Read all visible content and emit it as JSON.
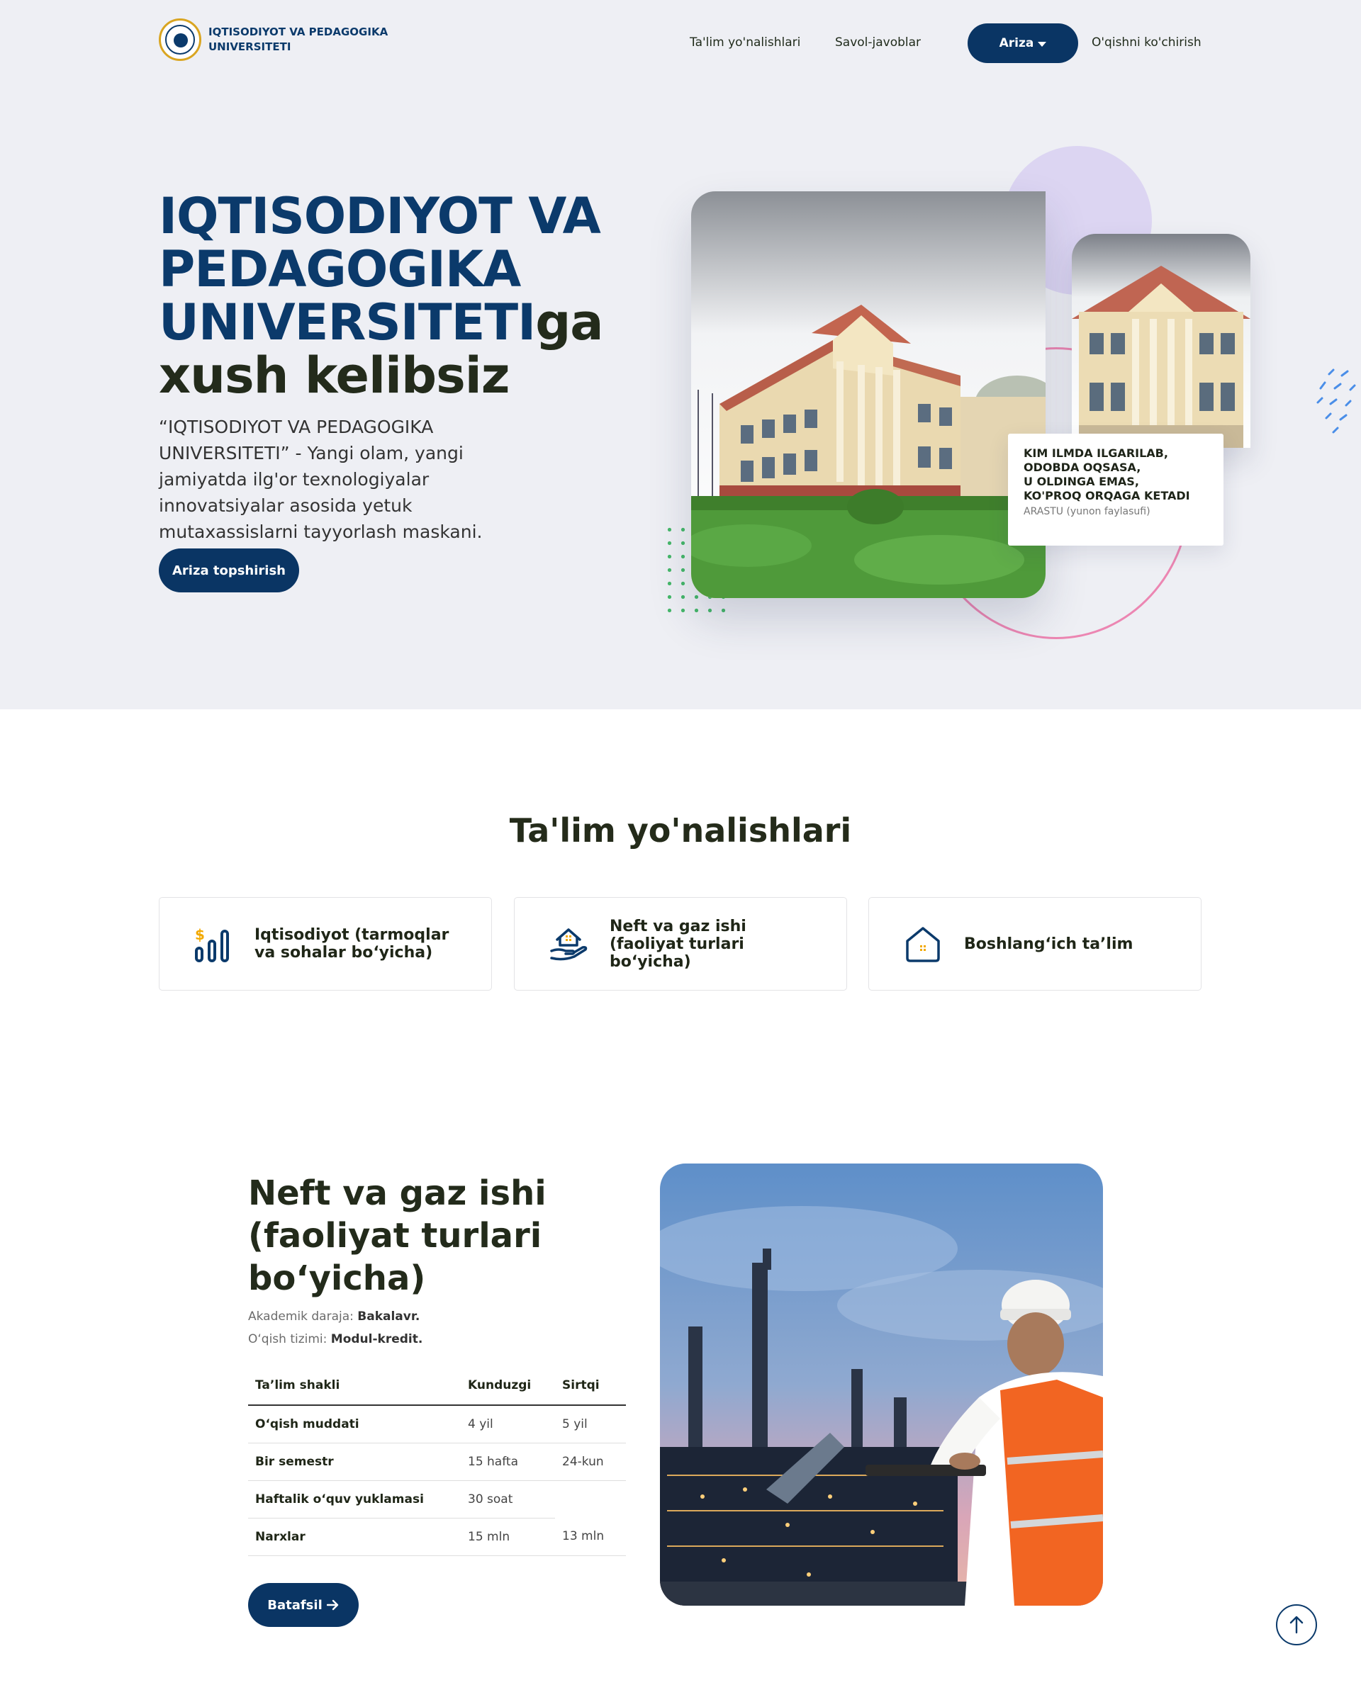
{
  "header": {
    "logo_text": "IQTISODIYOT VA PEDAGOGIKA UNIVERSITETI",
    "nav": [
      {
        "label": "Ta'lim yo'nalishlari"
      },
      {
        "label": "Savol-javoblar"
      },
      {
        "label": "Ariza"
      },
      {
        "label": "O'qishni ko'chirish"
      }
    ]
  },
  "hero": {
    "title_accent": "IQTISODIYOT VA PEDAGOGIKA UNIVERSITETI",
    "title_suffix": "ga",
    "title_dark": "xush kelibsiz",
    "description": "“IQTISODIYOT VA PEDAGOGIKA UNIVERSITETI” - Yangi olam, yangi jamiyatda ilg'or texnologiyalar innovatsiyalar asosida yetuk mutaxassislarni tayyorlash maskani.",
    "button_label": "Ariza topshirish",
    "quote_text": "KIM ILMDA ILGARILAB,\nODOBDA OQSASA,\nU OLDINGA EMAS,\nKO'PROQ ORQAGA KETADI",
    "quote_author": "ARASTU (yunon faylasufi)"
  },
  "directions": {
    "title": "Ta'lim yo'nalishlari",
    "items": [
      {
        "label": "Iqtisodiyot (tarmoqlar va sohalar bo‘yicha)",
        "icon": "finance-chart-icon"
      },
      {
        "label": "Neft va gaz ishi (faoliyat turlari bo‘yicha)",
        "icon": "hand-house-icon"
      },
      {
        "label": "Boshlang‘ich ta’lim",
        "icon": "house-icon"
      }
    ]
  },
  "program": {
    "title": "Neft va gaz ishi (faoliyat turlari bo‘yicha)",
    "degree_label": "Akademik daraja:",
    "degree_value": "Bakalavr.",
    "system_label": "O‘qish tizimi:",
    "system_value": "Modul-kredit.",
    "table": {
      "headers": [
        "Ta’lim shakli",
        "Kunduzgi",
        "Sirtqi"
      ],
      "rows": [
        [
          "O‘qish muddati",
          "4 yil",
          "5 yil"
        ],
        [
          "Bir semestr",
          "15 hafta",
          "24-kun"
        ],
        [
          "Haftalik o‘quv yuklamasi",
          "30 soat",
          ""
        ],
        [
          "Narxlar",
          "15 mln",
          "13 mln"
        ]
      ]
    },
    "button_label": "Batafsil"
  },
  "colors": {
    "primary": "#0a3564",
    "hero_bg": "#eeeff4",
    "accent_gold": "#f2a900"
  }
}
